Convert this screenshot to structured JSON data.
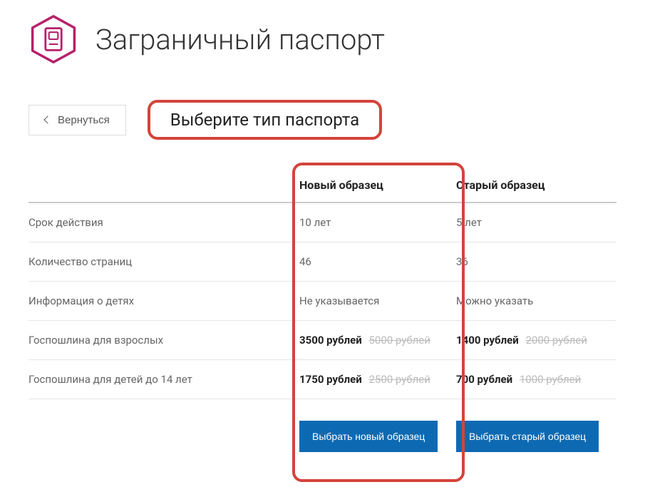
{
  "header": {
    "title": "Заграничный паспорт",
    "back_label": "Вернуться",
    "section_title": "Выберите тип паспорта"
  },
  "columns": {
    "new_label": "Новый образец",
    "old_label": "Старый образец"
  },
  "rows": {
    "validity": {
      "label": "Срок действия",
      "new": "10 лет",
      "old": "5 лет"
    },
    "pages": {
      "label": "Количество страниц",
      "new": "46",
      "old": "36"
    },
    "children": {
      "label": "Информация о детях",
      "new": "Не указывается",
      "old": "Можно указать"
    },
    "fee_adult": {
      "label": "Госпошлина для взрослых",
      "new_price": "3500 рублей",
      "new_struck": "5000 рублей",
      "old_price": "1400 рублей",
      "old_struck": "2000 рублей"
    },
    "fee_child": {
      "label": "Госпошлина для детей до 14 лет",
      "new_price": "1750 рублей",
      "new_struck": "2500 рублей",
      "old_price": "700 рублей",
      "old_struck": "1000 рублей"
    }
  },
  "buttons": {
    "select_new": "Выбрать новый образец",
    "select_old": "Выбрать старый образец"
  }
}
